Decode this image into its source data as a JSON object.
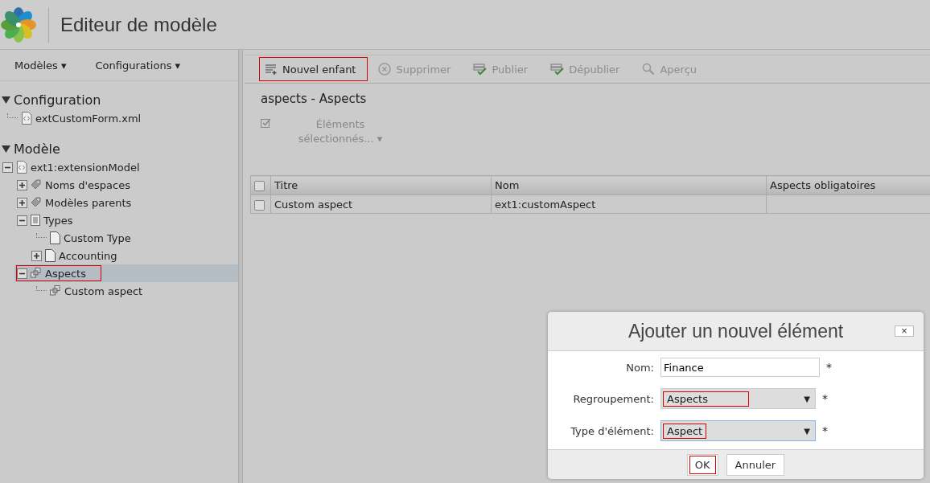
{
  "header": {
    "title": "Editeur de modèle"
  },
  "menus": [
    {
      "label": "Modèles",
      "caret": "▾"
    },
    {
      "label": "Configurations",
      "caret": "▾"
    }
  ],
  "tree_sections": [
    {
      "title": "Configuration",
      "expanded": true,
      "children": [
        {
          "label": "extCustomForm.xml",
          "kind": "code",
          "selected": false,
          "highlighted": false
        }
      ]
    },
    {
      "title": "Modèle",
      "expanded": true,
      "children": [
        {
          "label": "ext1:extensionModel",
          "kind": "code",
          "expanded": true,
          "selected": false,
          "highlighted": false,
          "children": [
            {
              "label": "Noms d'espaces",
              "kind": "tag",
              "expanded": false,
              "selected": false,
              "highlighted": false
            },
            {
              "label": "Modèles parents",
              "kind": "tag",
              "expanded": false,
              "selected": false,
              "highlighted": false
            },
            {
              "label": "Types",
              "kind": "list",
              "expanded": true,
              "selected": false,
              "highlighted": false,
              "children": [
                {
                  "label": "Custom Type",
                  "kind": "page",
                  "selected": false,
                  "highlighted": false
                },
                {
                  "label": "Accounting",
                  "kind": "page",
                  "expanded": false,
                  "selected": false,
                  "highlighted": false
                }
              ]
            },
            {
              "label": "Aspects",
              "kind": "aspect",
              "expanded": true,
              "selected": true,
              "highlighted": true,
              "children": [
                {
                  "label": "Custom aspect",
                  "kind": "aspect",
                  "selected": false,
                  "highlighted": false
                }
              ]
            }
          ]
        }
      ]
    }
  ],
  "toolbar": [
    {
      "label": "Nouvel enfant",
      "kind": "add",
      "disabled": false,
      "highlighted": true
    },
    {
      "label": "Supprimer",
      "kind": "delete",
      "disabled": true,
      "highlighted": false
    },
    {
      "label": "Publier",
      "kind": "publish",
      "disabled": true,
      "highlighted": false
    },
    {
      "label": "Dépublier",
      "kind": "publish",
      "disabled": true,
      "highlighted": false
    },
    {
      "label": "Aperçu",
      "kind": "search",
      "disabled": true,
      "highlighted": false
    }
  ],
  "content_title": "aspects - Aspects",
  "selection_menu": {
    "label": "Éléments sélectionnés...",
    "caret": "▾",
    "disabled": true
  },
  "table": {
    "select_all_checked": false,
    "columns": [
      "Titre",
      "Nom",
      "Aspects obligatoires"
    ],
    "rows": [
      {
        "checked": false,
        "cells": [
          "Custom aspect",
          "ext1:customAspect",
          ""
        ]
      }
    ]
  },
  "dialog": {
    "title": "Ajouter un nouvel élément",
    "close": "×",
    "fields": [
      {
        "kind": "text",
        "label": "Nom:",
        "value": "Finance",
        "required": "*"
      },
      {
        "kind": "select",
        "label": "Regroupement:",
        "value": "Aspects",
        "caret": "▼",
        "required": "*",
        "focused": false,
        "highlighted": true
      },
      {
        "kind": "select",
        "label": "Type d'élément:",
        "value": "Aspect",
        "caret": "▼",
        "required": "*",
        "focused": true,
        "highlighted": true
      }
    ],
    "buttons": [
      {
        "label": "OK",
        "highlighted": true
      },
      {
        "label": "Annuler",
        "highlighted": false
      }
    ]
  }
}
